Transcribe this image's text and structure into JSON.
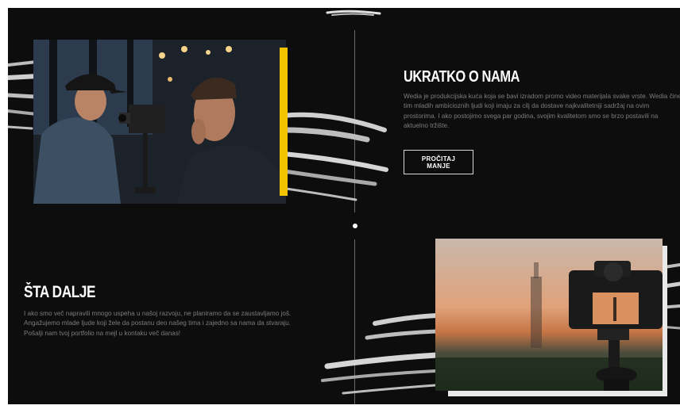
{
  "about": {
    "title": "UKRATKO O NAMA",
    "description": "Wedia je produkcijska kuća koja se bavi izradom promo video materijala svake vrste. Wedia čine tim mladih ambicioznih ljudi koji imaju za cilj da dostave najkvalitetniji sadržaj na ovim prostorima. I ako postojimo svega par godina, svojim kvalitetom smo se brzo postavili na aktuelno tržište.",
    "button_label": "PROČITAJ MANJE"
  },
  "next": {
    "title": "ŠTA DALJE",
    "description": "I ako smo več napravili mnogo uspeha u našoj razvoju, ne planiramo da se zaustavljamo još. Angažujemo mlade ljude koji žele da postanu deo našeg tima i zajedno sa nama da stvaraju. Pošalji nam tvoj portfolio na mejl u kontaku več danas!"
  },
  "colors": {
    "background": "#0d0d0d",
    "accent_yellow": "#f2c400",
    "text_muted": "#7c7c7c",
    "brush": "#bdbdbd"
  }
}
